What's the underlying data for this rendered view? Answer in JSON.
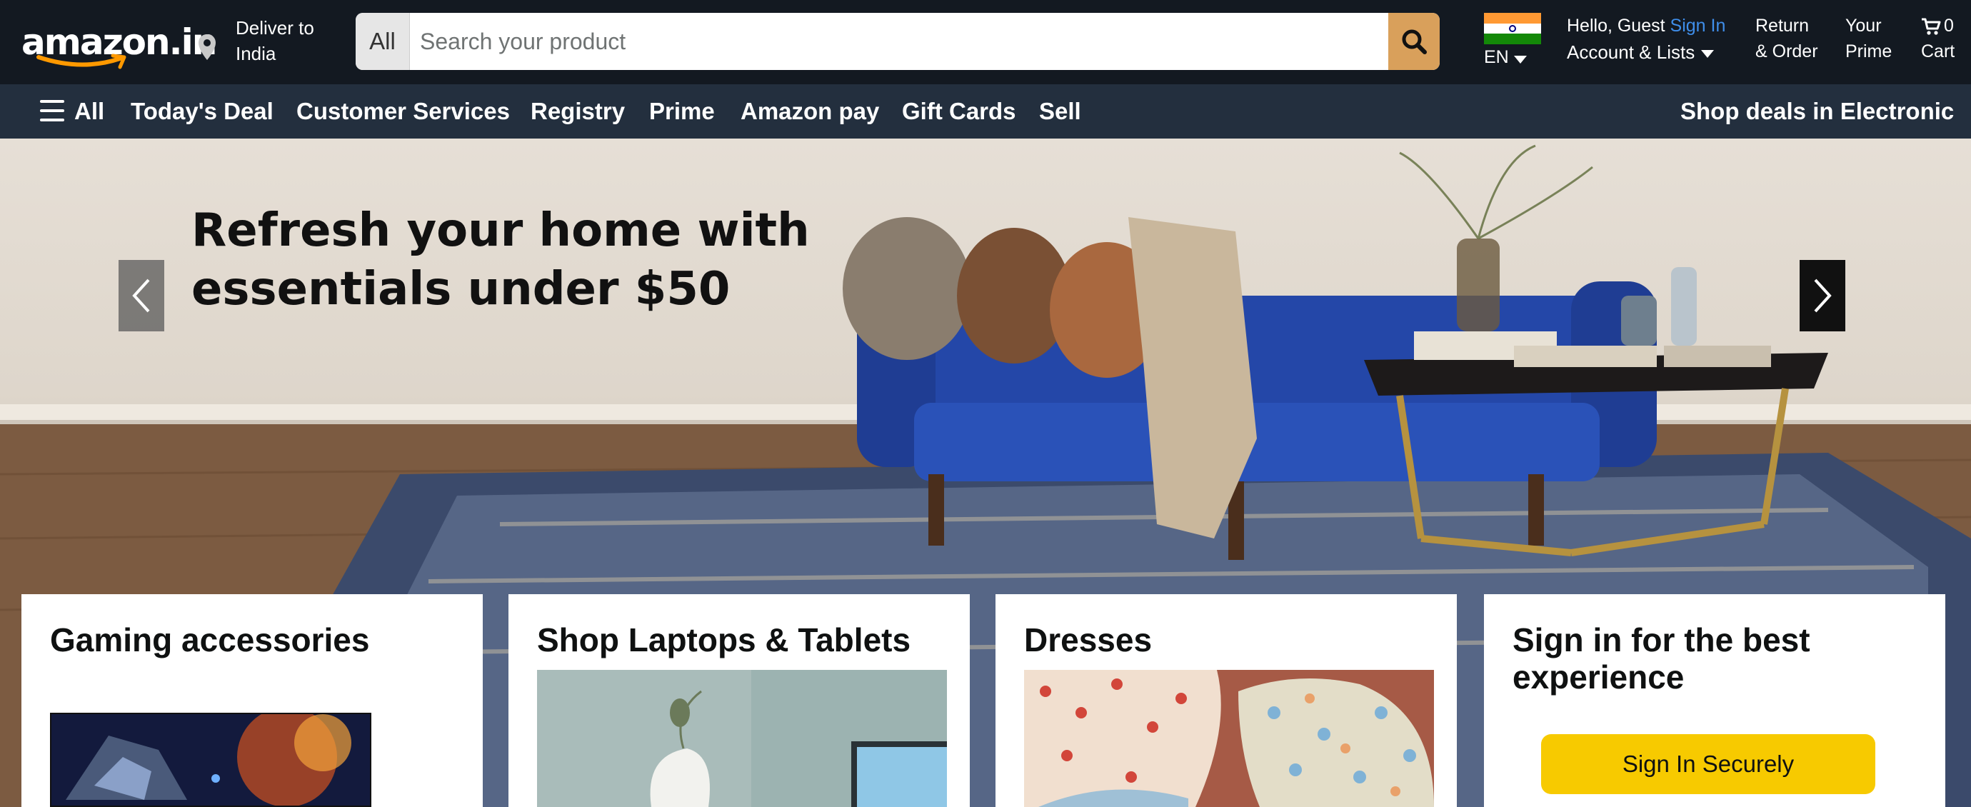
{
  "header": {
    "logo_text": "amazon.in",
    "deliver": {
      "line1": "Deliver to",
      "line2": "India"
    },
    "search": {
      "category": "All",
      "placeholder": "Search your product",
      "value": ""
    },
    "language": {
      "code": "EN"
    },
    "account": {
      "greeting": "Hello, Guest",
      "sign_in": "Sign In",
      "line2": "Account & Lists"
    },
    "returns": {
      "line1": "Return",
      "line2": "& Order"
    },
    "prime": {
      "line1": "Your",
      "line2": "Prime"
    },
    "cart": {
      "count": "0",
      "label": "Cart"
    }
  },
  "subnav": {
    "all_label": "All",
    "items": [
      "Today's Deal",
      "Customer Services",
      "Registry",
      "Prime",
      "Amazon pay",
      "Gift Cards",
      "Sell"
    ],
    "right_link": "Shop deals in Electronic"
  },
  "hero": {
    "line1": "Refresh your home with",
    "line2": "essentials under $50"
  },
  "cards": [
    {
      "title": "Gaming accessories"
    },
    {
      "title": "Shop Laptops & Tablets"
    },
    {
      "title": "Dresses"
    },
    {
      "title": "Sign in for the best experience",
      "button": "Sign In Securely"
    }
  ],
  "colors": {
    "topbar": "#131921",
    "subnav": "#232f3e",
    "search_button": "#d9a05b",
    "sign_in_link": "#3f8eea",
    "sign_in_button": "#f7ca00"
  }
}
